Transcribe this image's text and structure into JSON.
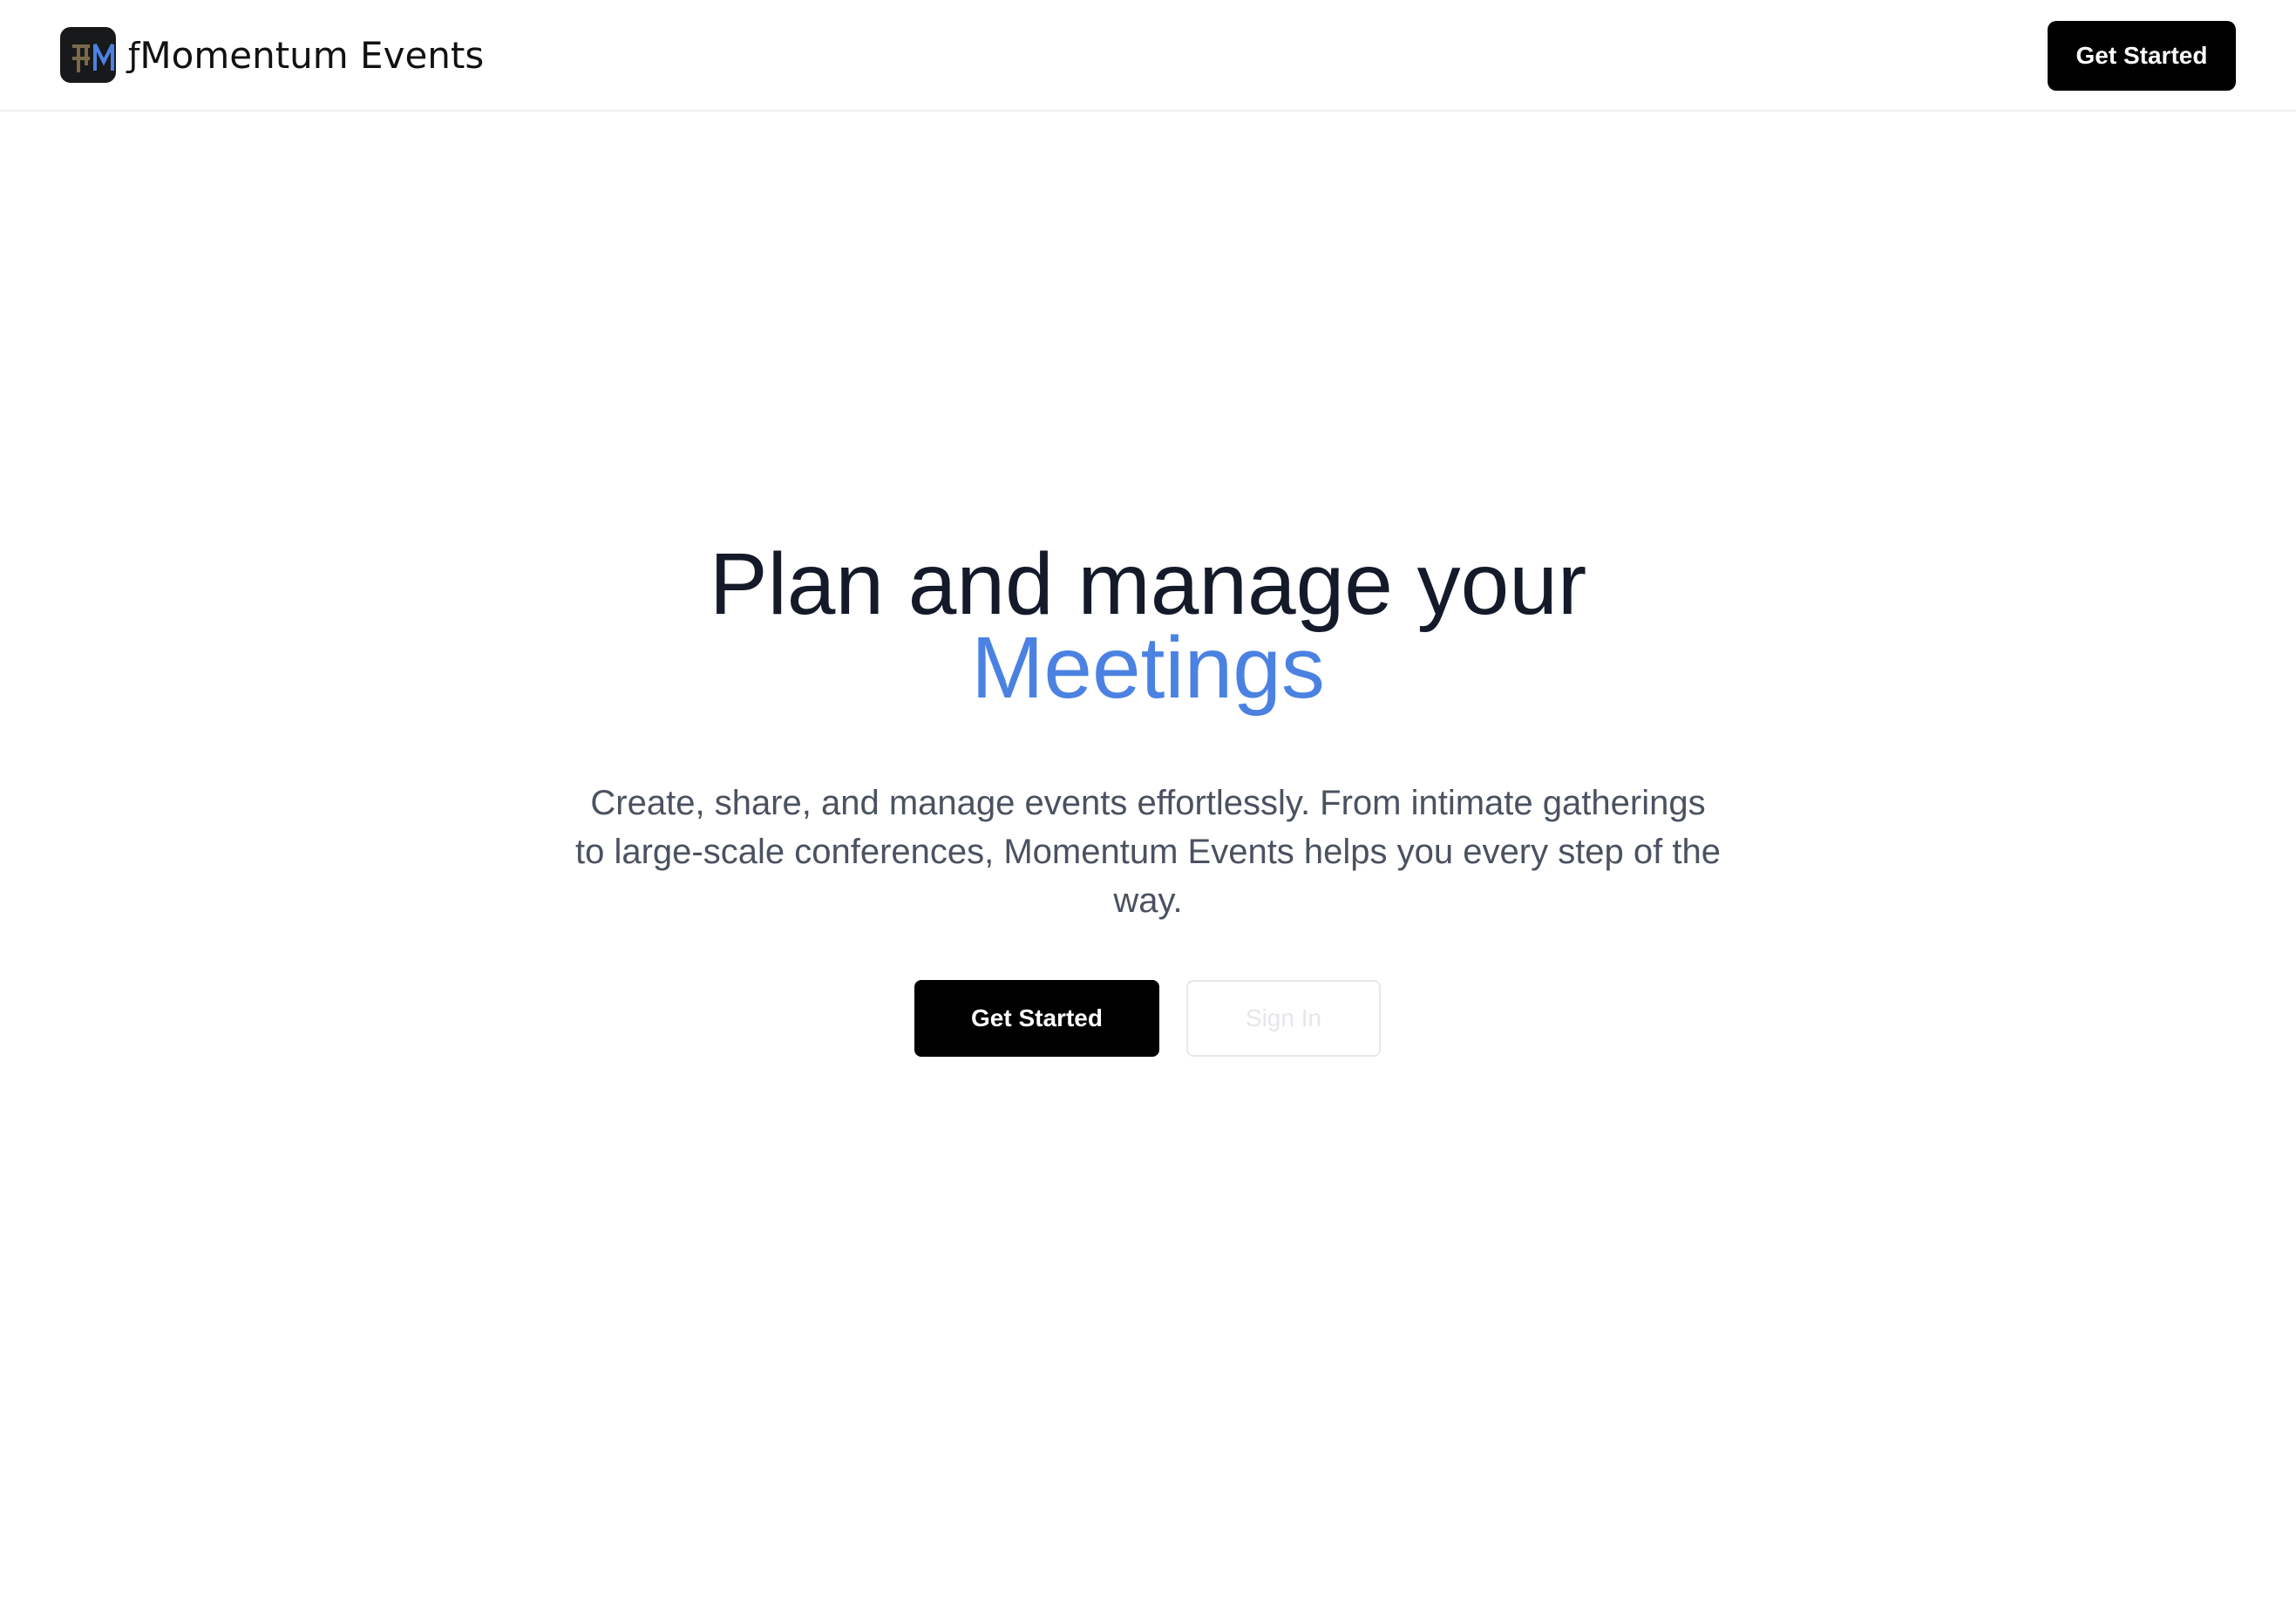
{
  "header": {
    "brand_glyph": "ƒ",
    "brand_name": "Momentum Events",
    "logo_icon": "momentum-events-logo-icon",
    "cta_label": "Get Started"
  },
  "hero": {
    "headline_line1": "Plan and manage your",
    "headline_line2": "Meetings",
    "subtitle": "Create, share, and manage events effortlessly. From intimate gatherings to large-scale conferences, Momentum Events helps you every step of the way.",
    "primary_cta_label": "Get Started",
    "secondary_cta_label": "Sign In"
  },
  "colors": {
    "accent": "#4b82e2",
    "headline": "#141a29",
    "subtitle": "#4a5261",
    "button_primary_bg": "#000000",
    "button_primary_text": "#ffffff",
    "logo_bg": "#18191b"
  }
}
